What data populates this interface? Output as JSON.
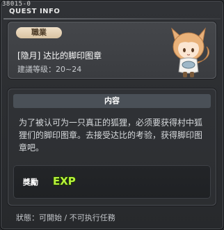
{
  "window": {
    "quest_id": "38015-0",
    "title": "QUEST INFO"
  },
  "header": {
    "job_badge": "職業",
    "quest_name": "[隐月] 达比的脚印图章",
    "level_label": "建議等级：",
    "level_value": "20~24",
    "npc_icon": "fox-girl-npc-icon"
  },
  "content": {
    "section_title": "内容",
    "description": "为了被认可为一只真正的狐狸，必须要获得村中狐狸们的脚印图章。去接受达比的考验，获得脚印图章吧。"
  },
  "reward": {
    "label": "獎勵",
    "exp_text": "EXP",
    "icon": "exp-icon"
  },
  "status": {
    "label": "狀態：",
    "value": "可開始 / 不可执行任務"
  },
  "colors": {
    "badge_bg": "#e6d3b6",
    "title_bar_bg": "#4a5057",
    "exp_green": "#b7f23a"
  }
}
